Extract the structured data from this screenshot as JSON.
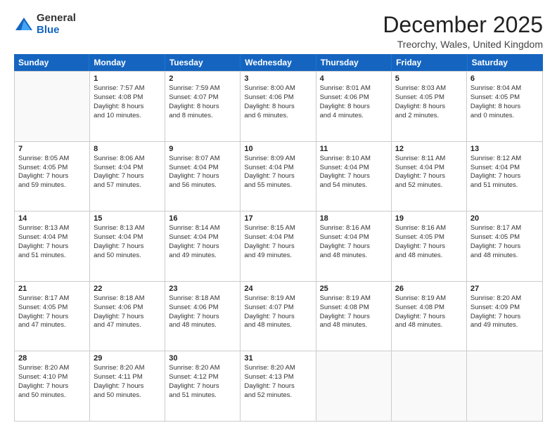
{
  "logo": {
    "general": "General",
    "blue": "Blue"
  },
  "title": "December 2025",
  "subtitle": "Treorchy, Wales, United Kingdom",
  "header_days": [
    "Sunday",
    "Monday",
    "Tuesday",
    "Wednesday",
    "Thursday",
    "Friday",
    "Saturday"
  ],
  "weeks": [
    [
      {
        "day": "",
        "sunrise": "",
        "sunset": "",
        "daylight": ""
      },
      {
        "day": "1",
        "sunrise": "Sunrise: 7:57 AM",
        "sunset": "Sunset: 4:08 PM",
        "daylight": "Daylight: 8 hours",
        "daylight2": "and 10 minutes."
      },
      {
        "day": "2",
        "sunrise": "Sunrise: 7:59 AM",
        "sunset": "Sunset: 4:07 PM",
        "daylight": "Daylight: 8 hours",
        "daylight2": "and 8 minutes."
      },
      {
        "day": "3",
        "sunrise": "Sunrise: 8:00 AM",
        "sunset": "Sunset: 4:06 PM",
        "daylight": "Daylight: 8 hours",
        "daylight2": "and 6 minutes."
      },
      {
        "day": "4",
        "sunrise": "Sunrise: 8:01 AM",
        "sunset": "Sunset: 4:06 PM",
        "daylight": "Daylight: 8 hours",
        "daylight2": "and 4 minutes."
      },
      {
        "day": "5",
        "sunrise": "Sunrise: 8:03 AM",
        "sunset": "Sunset: 4:05 PM",
        "daylight": "Daylight: 8 hours",
        "daylight2": "and 2 minutes."
      },
      {
        "day": "6",
        "sunrise": "Sunrise: 8:04 AM",
        "sunset": "Sunset: 4:05 PM",
        "daylight": "Daylight: 8 hours",
        "daylight2": "and 0 minutes."
      }
    ],
    [
      {
        "day": "7",
        "sunrise": "Sunrise: 8:05 AM",
        "sunset": "Sunset: 4:05 PM",
        "daylight": "Daylight: 7 hours",
        "daylight2": "and 59 minutes."
      },
      {
        "day": "8",
        "sunrise": "Sunrise: 8:06 AM",
        "sunset": "Sunset: 4:04 PM",
        "daylight": "Daylight: 7 hours",
        "daylight2": "and 57 minutes."
      },
      {
        "day": "9",
        "sunrise": "Sunrise: 8:07 AM",
        "sunset": "Sunset: 4:04 PM",
        "daylight": "Daylight: 7 hours",
        "daylight2": "and 56 minutes."
      },
      {
        "day": "10",
        "sunrise": "Sunrise: 8:09 AM",
        "sunset": "Sunset: 4:04 PM",
        "daylight": "Daylight: 7 hours",
        "daylight2": "and 55 minutes."
      },
      {
        "day": "11",
        "sunrise": "Sunrise: 8:10 AM",
        "sunset": "Sunset: 4:04 PM",
        "daylight": "Daylight: 7 hours",
        "daylight2": "and 54 minutes."
      },
      {
        "day": "12",
        "sunrise": "Sunrise: 8:11 AM",
        "sunset": "Sunset: 4:04 PM",
        "daylight": "Daylight: 7 hours",
        "daylight2": "and 52 minutes."
      },
      {
        "day": "13",
        "sunrise": "Sunrise: 8:12 AM",
        "sunset": "Sunset: 4:04 PM",
        "daylight": "Daylight: 7 hours",
        "daylight2": "and 51 minutes."
      }
    ],
    [
      {
        "day": "14",
        "sunrise": "Sunrise: 8:13 AM",
        "sunset": "Sunset: 4:04 PM",
        "daylight": "Daylight: 7 hours",
        "daylight2": "and 51 minutes."
      },
      {
        "day": "15",
        "sunrise": "Sunrise: 8:13 AM",
        "sunset": "Sunset: 4:04 PM",
        "daylight": "Daylight: 7 hours",
        "daylight2": "and 50 minutes."
      },
      {
        "day": "16",
        "sunrise": "Sunrise: 8:14 AM",
        "sunset": "Sunset: 4:04 PM",
        "daylight": "Daylight: 7 hours",
        "daylight2": "and 49 minutes."
      },
      {
        "day": "17",
        "sunrise": "Sunrise: 8:15 AM",
        "sunset": "Sunset: 4:04 PM",
        "daylight": "Daylight: 7 hours",
        "daylight2": "and 49 minutes."
      },
      {
        "day": "18",
        "sunrise": "Sunrise: 8:16 AM",
        "sunset": "Sunset: 4:04 PM",
        "daylight": "Daylight: 7 hours",
        "daylight2": "and 48 minutes."
      },
      {
        "day": "19",
        "sunrise": "Sunrise: 8:16 AM",
        "sunset": "Sunset: 4:05 PM",
        "daylight": "Daylight: 7 hours",
        "daylight2": "and 48 minutes."
      },
      {
        "day": "20",
        "sunrise": "Sunrise: 8:17 AM",
        "sunset": "Sunset: 4:05 PM",
        "daylight": "Daylight: 7 hours",
        "daylight2": "and 48 minutes."
      }
    ],
    [
      {
        "day": "21",
        "sunrise": "Sunrise: 8:17 AM",
        "sunset": "Sunset: 4:05 PM",
        "daylight": "Daylight: 7 hours",
        "daylight2": "and 47 minutes."
      },
      {
        "day": "22",
        "sunrise": "Sunrise: 8:18 AM",
        "sunset": "Sunset: 4:06 PM",
        "daylight": "Daylight: 7 hours",
        "daylight2": "and 47 minutes."
      },
      {
        "day": "23",
        "sunrise": "Sunrise: 8:18 AM",
        "sunset": "Sunset: 4:06 PM",
        "daylight": "Daylight: 7 hours",
        "daylight2": "and 48 minutes."
      },
      {
        "day": "24",
        "sunrise": "Sunrise: 8:19 AM",
        "sunset": "Sunset: 4:07 PM",
        "daylight": "Daylight: 7 hours",
        "daylight2": "and 48 minutes."
      },
      {
        "day": "25",
        "sunrise": "Sunrise: 8:19 AM",
        "sunset": "Sunset: 4:08 PM",
        "daylight": "Daylight: 7 hours",
        "daylight2": "and 48 minutes."
      },
      {
        "day": "26",
        "sunrise": "Sunrise: 8:19 AM",
        "sunset": "Sunset: 4:08 PM",
        "daylight": "Daylight: 7 hours",
        "daylight2": "and 48 minutes."
      },
      {
        "day": "27",
        "sunrise": "Sunrise: 8:20 AM",
        "sunset": "Sunset: 4:09 PM",
        "daylight": "Daylight: 7 hours",
        "daylight2": "and 49 minutes."
      }
    ],
    [
      {
        "day": "28",
        "sunrise": "Sunrise: 8:20 AM",
        "sunset": "Sunset: 4:10 PM",
        "daylight": "Daylight: 7 hours",
        "daylight2": "and 50 minutes."
      },
      {
        "day": "29",
        "sunrise": "Sunrise: 8:20 AM",
        "sunset": "Sunset: 4:11 PM",
        "daylight": "Daylight: 7 hours",
        "daylight2": "and 50 minutes."
      },
      {
        "day": "30",
        "sunrise": "Sunrise: 8:20 AM",
        "sunset": "Sunset: 4:12 PM",
        "daylight": "Daylight: 7 hours",
        "daylight2": "and 51 minutes."
      },
      {
        "day": "31",
        "sunrise": "Sunrise: 8:20 AM",
        "sunset": "Sunset: 4:13 PM",
        "daylight": "Daylight: 7 hours",
        "daylight2": "and 52 minutes."
      },
      {
        "day": "",
        "sunrise": "",
        "sunset": "",
        "daylight": ""
      },
      {
        "day": "",
        "sunrise": "",
        "sunset": "",
        "daylight": ""
      },
      {
        "day": "",
        "sunrise": "",
        "sunset": "",
        "daylight": ""
      }
    ]
  ]
}
